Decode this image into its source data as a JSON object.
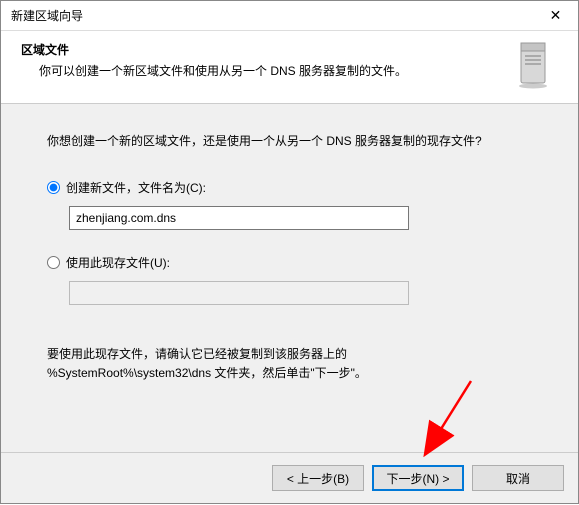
{
  "title": "新建区域向导",
  "header": {
    "heading": "区域文件",
    "sub": "你可以创建一个新区域文件和使用从另一个 DNS 服务器复制的文件。"
  },
  "body": {
    "prompt": "你想创建一个新的区域文件，还是使用一个从另一个 DNS 服务器复制的现存文件?",
    "option1_label": "创建新文件，文件名为(C):",
    "option1_value": "zhenjiang.com.dns",
    "option2_label": "使用此现存文件(U):",
    "option2_value": "",
    "note_line1": "要使用此现存文件，请确认它已经被复制到该服务器上的",
    "note_line2": "%SystemRoot%\\system32\\dns 文件夹，然后单击\"下一步\"。"
  },
  "footer": {
    "back": "< 上一步(B)",
    "next": "下一步(N) >",
    "cancel": "取消"
  }
}
